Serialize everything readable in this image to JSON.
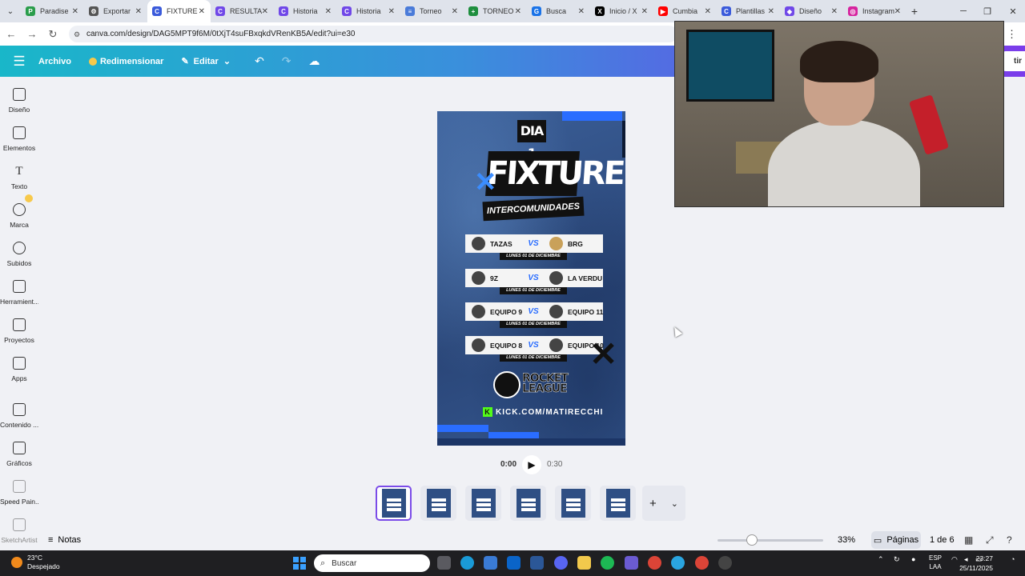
{
  "browser": {
    "tabs": [
      {
        "label": "Paradise",
        "color": "#2a9d4b",
        "glyph": "P"
      },
      {
        "label": "Exportar",
        "color": "#555555",
        "glyph": "⚙"
      },
      {
        "label": "FIXTURE",
        "color": "#3b5bdb",
        "glyph": "C",
        "active": true
      },
      {
        "label": "RESULTA",
        "color": "#7048e8",
        "glyph": "C"
      },
      {
        "label": "Historia",
        "color": "#7048e8",
        "glyph": "C"
      },
      {
        "label": "Historia",
        "color": "#7048e8",
        "glyph": "C"
      },
      {
        "label": "Torneo",
        "color": "#4a7bd9",
        "glyph": "≡"
      },
      {
        "label": "TORNEO",
        "color": "#1e8e3e",
        "glyph": "+"
      },
      {
        "label": "Busca",
        "color": "#1a73e8",
        "glyph": "G"
      },
      {
        "label": "Inicio / X",
        "color": "#000000",
        "glyph": "X"
      },
      {
        "label": "Cumbia",
        "color": "#ff0000",
        "glyph": "▶"
      },
      {
        "label": "Plantillas",
        "color": "#3b5bdb",
        "glyph": "C"
      },
      {
        "label": "Diseño",
        "color": "#7048e8",
        "glyph": "◆"
      },
      {
        "label": "Instagram",
        "color": "#d6249f",
        "glyph": "◎"
      }
    ],
    "url": "canva.com/design/DAG5MPT9f6M/0tXjT4suFBxqkdVRenKB5A/edit?ui=e30"
  },
  "header": {
    "archivo": "Archivo",
    "redimensionar": "Redimensionar",
    "editar": "Editar",
    "share_fragment": "tir"
  },
  "sidebar": {
    "items": [
      {
        "label": "Diseño",
        "icon": "layout-icon"
      },
      {
        "label": "Elementos",
        "icon": "shapes-icon"
      },
      {
        "label": "Texto",
        "icon": "text-icon"
      },
      {
        "label": "Marca",
        "icon": "brand-icon"
      },
      {
        "label": "Subidos",
        "icon": "upload-cloud-icon"
      },
      {
        "label": "Herramient...",
        "icon": "draw-icon"
      },
      {
        "label": "Proyectos",
        "icon": "folder-icon"
      },
      {
        "label": "Apps",
        "icon": "apps-icon"
      },
      {
        "label": "Contenido ...",
        "icon": "image-icon"
      },
      {
        "label": "Gráficos",
        "icon": "chart-icon"
      },
      {
        "label": "Speed Pain...",
        "icon": "speed-paint-icon"
      },
      {
        "label": "SketchArtist",
        "icon": "sketch-artist-icon"
      }
    ]
  },
  "poster": {
    "day": "DIA 1",
    "title": "FIXTURE",
    "subtitle": "INTERCOMUNIDADES",
    "vs": "VS",
    "matches": [
      {
        "home": "TAZAS",
        "away": "BRG",
        "date": "LUNES 01 DE DICIEMBRE"
      },
      {
        "home": "9Z",
        "away": "LA VERDU",
        "date": "LUNES 01 DE DICIEMBRE"
      },
      {
        "home": "EQUIPO 9",
        "away": "EQUIPO 11",
        "date": "LUNES 01 DE DICIEMBRE"
      },
      {
        "home": "EQUIPO 8",
        "away": "EQUIPO 10",
        "date": "LUNES 01 DE DICIEMBRE"
      }
    ],
    "brand_line1": "ROCKET",
    "brand_line2": "LEAGUE",
    "kick": "KICK.COM/MATIRECCHI"
  },
  "playback": {
    "current": "0:00",
    "duration": "0:30"
  },
  "pages": {
    "thumb_count": 6,
    "notes": "Notas",
    "zoom": "33%",
    "zoom_fraction": 0.33,
    "pages_label": "Páginas",
    "page_count": "1 de 6"
  },
  "taskbar": {
    "temperature": "23°C",
    "weather": "Despejado",
    "search_placeholder": "Buscar",
    "lang_line1": "ESP",
    "lang_line2": "LAA",
    "time": "23:27",
    "date": "25/11/2025"
  }
}
